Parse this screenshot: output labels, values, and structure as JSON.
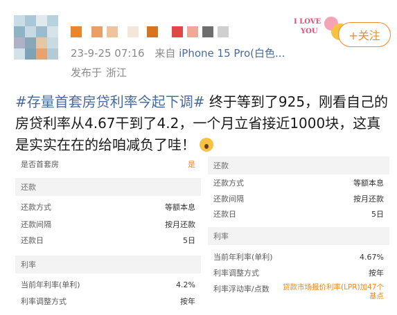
{
  "colors": {
    "link": "#476b9b",
    "accent": "#f08b2a",
    "meta_gray": "#8a8a8a",
    "section_bg": "#f3f3f3"
  },
  "post": {
    "timestamp": "23-9-25 07:16",
    "source_prefix": "来自",
    "device": "iPhone 15 Pro(白色...",
    "location_prefix": "发布于",
    "location": "浙江",
    "hashtag": "#存量首套房贷利率今起下调#",
    "body": " 终于等到了925，刚看自己的房贷利率从4.67干到了4.2，一个月立省接近1000块，这真是实实在在的给咱减负了哇！",
    "emoji": "scared-face-icon"
  },
  "sticker": {
    "line1": "I LOVE",
    "line2": "YOU"
  },
  "follow_button": "+关注",
  "left_panel": {
    "top_row": {
      "label": "是否首套房",
      "value": "是"
    },
    "repay_section": "还款",
    "repay_rows": [
      {
        "label": "还款方式",
        "value": "等额本息"
      },
      {
        "label": "还款间隔",
        "value": "按月还款"
      },
      {
        "label": "还款日",
        "value": "5日"
      }
    ],
    "rate_section": "利率",
    "rate_rows": [
      {
        "label": "当前年利率(单利)",
        "value": "4.2%"
      },
      {
        "label": "利率调整方式",
        "value": "按年"
      }
    ]
  },
  "right_panel": {
    "repay_section": "还款",
    "repay_rows": [
      {
        "label": "还款方式",
        "value": "等额本息"
      },
      {
        "label": "还款间隔",
        "value": "按月还款"
      },
      {
        "label": "还款日",
        "value": "5日"
      }
    ],
    "rate_section": "利率",
    "rate_rows": [
      {
        "label": "当前年利率(单利)",
        "value": "4.67%"
      },
      {
        "label": "利率调整方式",
        "value": "按年"
      },
      {
        "label": "利率浮动率/点数",
        "value_line1": "贷款市场报价利率(LPR)加47个",
        "value_line2": "基点"
      }
    ]
  }
}
